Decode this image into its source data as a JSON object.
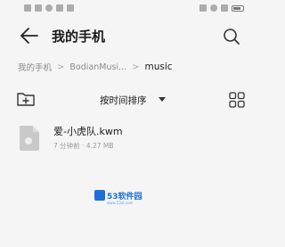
{
  "header": {
    "title": "我的手机"
  },
  "breadcrumb": {
    "items": [
      "我的手机",
      "BodianMusi...",
      "music"
    ]
  },
  "toolbar": {
    "sort_label": "按时间排序"
  },
  "files": [
    {
      "name": "爱-小虎队.kwm",
      "meta": "7 分钟前 · 4.27 MB"
    }
  ],
  "watermark": {
    "text": "53软件园",
    "sub": "www.53xt.com"
  },
  "icons": {
    "back": "arrow-left-icon",
    "search": "search-icon",
    "new_folder": "new-folder-icon",
    "sort": "caret-down-icon",
    "view": "grid-view-icon",
    "file": "file-icon"
  },
  "colors": {
    "background": "#f5f5f5",
    "text": "#1a1a1a",
    "secondary": "#8a8a8a",
    "watermark": "#1e6fd9"
  }
}
